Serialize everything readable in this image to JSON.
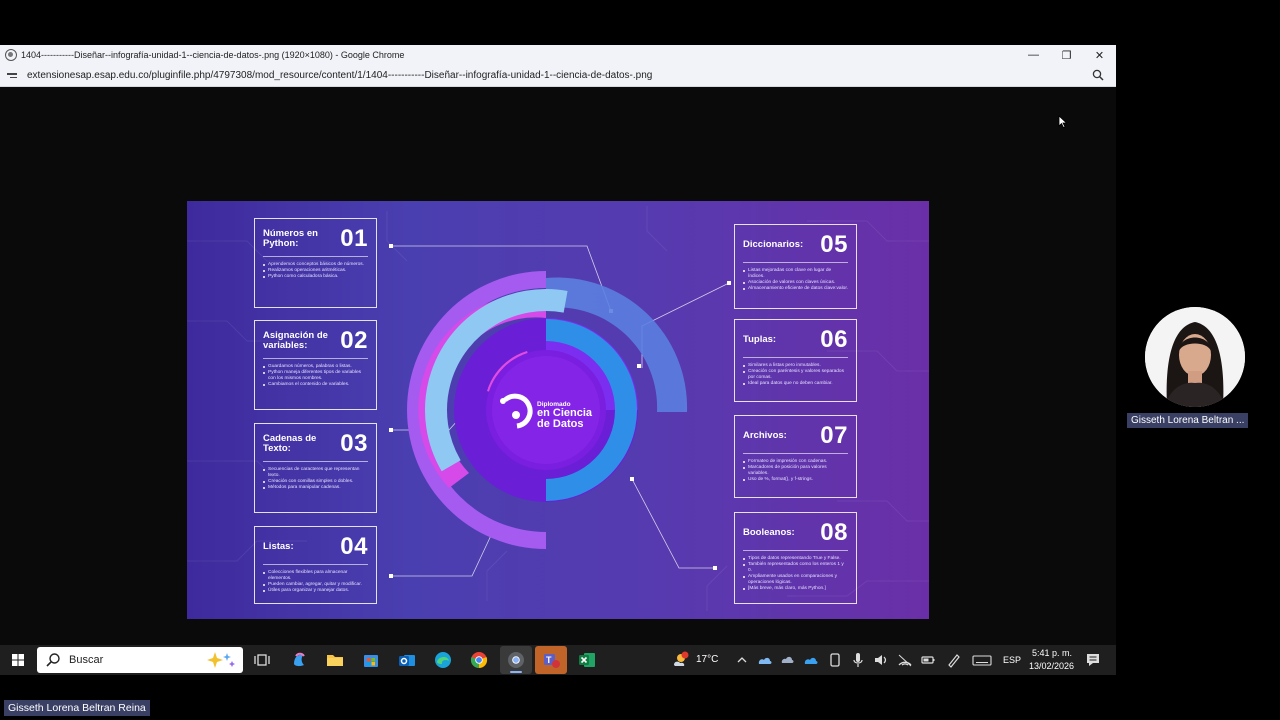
{
  "window": {
    "title": "1404-----------Diseñar--infografía-unidad-1--ciencia-de-datos-.png (1920×1080) - Google Chrome",
    "url": "extensionesap.esap.edu.co/pluginfile.php/4797308/mod_resource/content/1/1404-----------Diseñar--infografía-unidad-1--ciencia-de-datos-.png",
    "controls": [
      "—",
      "❐",
      "✕"
    ]
  },
  "infographic": {
    "logo": {
      "line1": "Diplomado",
      "line2": "en Ciencia",
      "line3": "de Datos"
    },
    "cards": [
      {
        "title": "Números en Python:",
        "number": "01",
        "bullets": [
          "Aprendemos conceptos básicos de números.",
          "Realizamos operaciones aritméticas.",
          "Python como calculadora básica."
        ]
      },
      {
        "title": "Asignación de variables:",
        "number": "02",
        "bullets": [
          "Guardamos números, palabras o listas.",
          "Python maneja diferentes tipos de variables con los mismos nombres.",
          "Cambiamos el contenido de variables."
        ]
      },
      {
        "title": "Cadenas de Texto:",
        "number": "03",
        "bullets": [
          "Secuencias de caracteres que representan texto.",
          "Creación con comillas simples o dobles.",
          "Métodos para manipular cadenas."
        ]
      },
      {
        "title": "Listas:",
        "number": "04",
        "bullets": [
          "Colecciones flexibles para almacenar elementos.",
          "Pueden cambiar, agregar, quitar y modificar.",
          "Útiles para organizar y manejar datos."
        ]
      },
      {
        "title": "Diccionarios:",
        "number": "05",
        "bullets": [
          "Listas mejoradas con clave en lugar de índices.",
          "Asociación de valores con claves únicas.",
          "Almacenamiento eficiente de datos clave:valor."
        ]
      },
      {
        "title": "Tuplas:",
        "number": "06",
        "bullets": [
          "Similares a listas pero inmutables.",
          "Creación con paréntesis y valores separados por comas.",
          "Ideal para datos que no deben cambiar."
        ]
      },
      {
        "title": "Archivos:",
        "number": "07",
        "bullets": [
          "Formateo de impresión con cadenas.",
          "Marcadores de posición para valores variables.",
          "Uso de %, format(), y f-strings."
        ]
      },
      {
        "title": "Booleanos:",
        "number": "08",
        "bullets": [
          "Tipos de datos representando True y False.",
          "También representados como los enteros 1 y 0.",
          "Ampliamente usados en comparaciones y operaciones lógicas.",
          "[Más breve, más claro, más Python.]"
        ]
      }
    ]
  },
  "taskbar": {
    "search_label": "Buscar",
    "weather": "17°C",
    "language": "ESP",
    "time": "5:41 p. m.",
    "date": "13/02/2026"
  },
  "participant": {
    "tile_name": "Gisseth Lorena Beltran ...",
    "full_name": "Gisseth Lorena Beltran Reina"
  },
  "colors": {
    "accent_magenta": "#d83be0",
    "accent_blue": "#2f8fe8",
    "accent_purple": "#7a1ee0",
    "name_tag_bg": "#3a3f64"
  }
}
